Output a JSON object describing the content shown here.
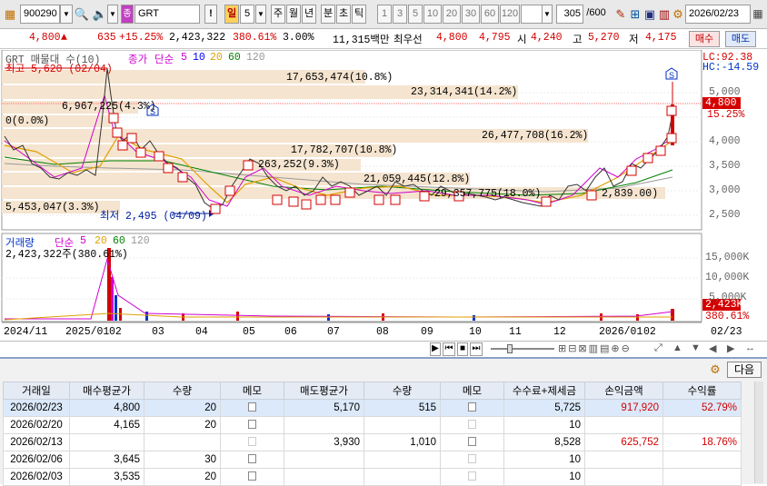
{
  "toolbar": {
    "code": "900290",
    "stock_name": "GRT",
    "stock_badge": "종",
    "period_buttons": [
      "일",
      "5",
      "주",
      "월",
      "년",
      "분",
      "초",
      "틱",
      "1",
      "3",
      "5",
      "10",
      "20",
      "30",
      "60",
      "120"
    ],
    "count": "305",
    "count_total": "/600",
    "date": "2026/02/23"
  },
  "quote": {
    "price": "4,800",
    "change": "635",
    "change_pct": "+15.25%",
    "volume": "2,423,322",
    "vol_ratio": "380.61%",
    "turnover": "3.00%",
    "amount": "11,315백만",
    "best_bid_label": "최우선",
    "ask": "4,800",
    "bid": "4,795",
    "open_label": "시",
    "open": "4,240",
    "high_label": "고",
    "high": "5,270",
    "low_label": "저",
    "low": "4,175",
    "buy_label": "매수",
    "sell_label": "매도"
  },
  "chart": {
    "legend_title": "GRT 매물대 수(10)",
    "legend_price": "종가",
    "legend_ma_type": "단순",
    "ma_periods": [
      "5",
      "10",
      "20",
      "60",
      "120"
    ],
    "lc": "LC:92.38",
    "hc": "HC:-14.59",
    "price_axis": [
      "5,000",
      "4,500",
      "4,000",
      "3,500",
      "3,000",
      "2,500"
    ],
    "current_price_tag": "4,800",
    "current_pct_tag": "15.25%",
    "high_marker": "최고 5,620 (02/04)",
    "low_marker": "최저 2,495 (04/09)",
    "pivot_label": "0(0.0%)",
    "bands": [
      "17,653,474(10.8%)",
      "23,314,341(14.2%)",
      "6,967,225(4.3%)",
      "26,477,708(16.2%)",
      "17,782,707(10.8%)",
      "263,252(9.3%)",
      "21,059,445(12.8%)",
      "5,453,047(3.3%)",
      "29,357,775(18.0%)",
      "2,839.00)"
    ],
    "volume_title": "거래량",
    "volume_ma_type": "단순",
    "volume_ma_periods": [
      "5",
      "20",
      "60",
      "120"
    ],
    "volume_value": "2,423,322주(380.61%)",
    "volume_axis": [
      "15,000K",
      "10,000K",
      "5,000K"
    ],
    "volume_tag": "2,423K",
    "volume_pct_tag": "380.61%",
    "date_axis": [
      "2024/11",
      "2025/01",
      "02",
      "03",
      "04",
      "05",
      "06",
      "07",
      "08",
      "09",
      "10",
      "11",
      "12",
      "2026/01",
      "02",
      "02/23"
    ]
  },
  "table": {
    "next_label": "다음",
    "headers": [
      "거래일",
      "매수평균가",
      "수량",
      "메모",
      "매도평균가",
      "수량",
      "메모",
      "수수료+제세금",
      "손익금액",
      "수익률"
    ],
    "rows": [
      {
        "date": "2026/02/23",
        "buy_avg": "4,800",
        "buy_qty": "20",
        "sell_avg": "5,170",
        "sell_qty": "515",
        "fee": "5,725",
        "pnl": "917,920",
        "yield": "52.79%"
      },
      {
        "date": "2026/02/20",
        "buy_avg": "4,165",
        "buy_qty": "20",
        "sell_avg": "",
        "sell_qty": "",
        "fee": "10",
        "pnl": "",
        "yield": ""
      },
      {
        "date": "2026/02/13",
        "buy_avg": "",
        "buy_qty": "",
        "sell_avg": "3,930",
        "sell_qty": "1,010",
        "fee": "8,528",
        "pnl": "625,752",
        "yield": "18.76%"
      },
      {
        "date": "2026/02/06",
        "buy_avg": "3,645",
        "buy_qty": "30",
        "sell_avg": "",
        "sell_qty": "",
        "fee": "10",
        "pnl": "",
        "yield": ""
      },
      {
        "date": "2026/02/03",
        "buy_avg": "3,535",
        "buy_qty": "20",
        "sell_avg": "",
        "sell_qty": "",
        "fee": "10",
        "pnl": "",
        "yield": ""
      }
    ]
  },
  "colors": {
    "up": "#d40000",
    "down": "#0033cc",
    "band": "#f3e3cf",
    "ma5": "#d000d0",
    "ma10": "#0000ff",
    "ma20": "#e0a000",
    "ma60": "#008000",
    "ma120": "#888888"
  }
}
